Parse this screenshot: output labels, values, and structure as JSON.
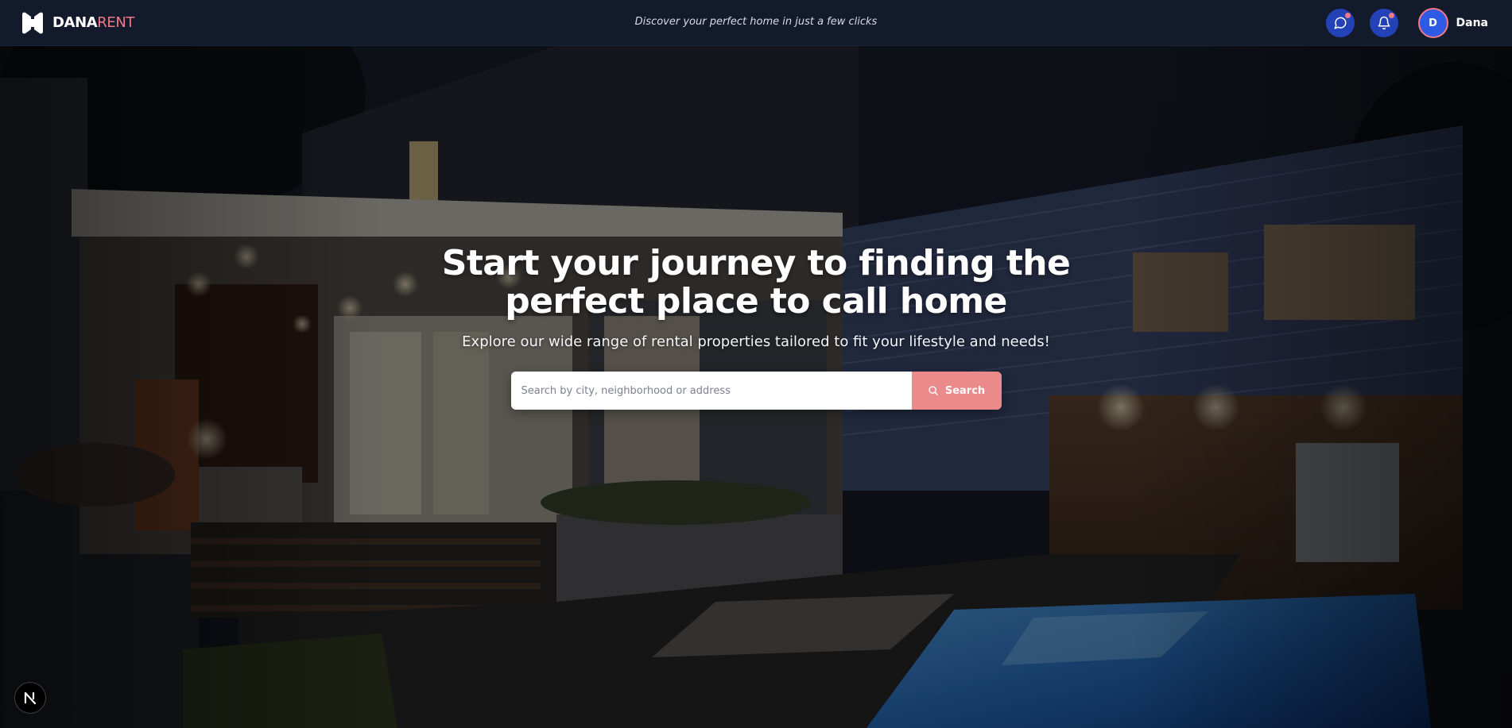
{
  "brand": {
    "name_bold": "DANA",
    "name_light": "RENT",
    "logo_icon": "bowtie-logo-icon"
  },
  "header": {
    "tagline": "Discover your perfect home in just a few clicks",
    "messages_icon": "chat-bubble-icon",
    "notifications_icon": "bell-icon",
    "user": {
      "initial": "D",
      "name": "Dana"
    }
  },
  "hero": {
    "title": "Start your journey to finding the perfect place to call home",
    "subtitle": "Explore our wide range of rental properties tailored to fit your lifestyle and needs!",
    "search": {
      "placeholder": "Search by city, neighborhood or address",
      "value": "",
      "button_label": "Search",
      "button_icon": "search-icon"
    }
  },
  "dev_badge": {
    "letter": "N"
  },
  "colors": {
    "topbar": "#121a2c",
    "accent": "#f07a84",
    "search_button": "#ea8a8a",
    "icon_button": "#2442b8",
    "avatar": "#2f5ae6"
  }
}
